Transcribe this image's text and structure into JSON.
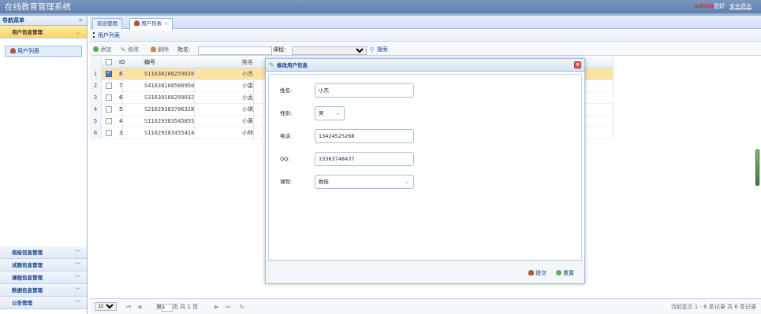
{
  "app": {
    "title": "在线教育管理系统"
  },
  "user": {
    "name": "admin",
    "greeting": "您好",
    "logout": "安全退出"
  },
  "sidebar": {
    "title": "导航菜单",
    "collapse": "«",
    "active_section": "用户信息管理",
    "active_items": [
      "用户列表"
    ],
    "sections": [
      "班级信息管理",
      "试题信息管理",
      "课程信息管理",
      "数据信息管理",
      "公告管理"
    ]
  },
  "tabs": [
    {
      "label": "欢迎使用"
    },
    {
      "label": "用户列表",
      "close": "×"
    }
  ],
  "breadcrumb": "用户列表",
  "toolbar": {
    "add": "添加",
    "edit": "修改",
    "delete": "删除",
    "name_label": "姓名:",
    "course_label": "课程:",
    "search": "搜索"
  },
  "grid": {
    "headers": {
      "id": "ID",
      "no": "编号",
      "name": "姓名"
    },
    "rows": [
      {
        "rn": "1",
        "id": "8",
        "no": "S11638200259020",
        "name": "小杰",
        "checked": true
      },
      {
        "rn": "2",
        "id": "7",
        "no": "S41638168580950",
        "name": "小雷",
        "checked": false
      },
      {
        "rn": "3",
        "id": "6",
        "no": "S31638168299032",
        "name": "小孟",
        "checked": false
      },
      {
        "rn": "4",
        "id": "5",
        "no": "S21629383706318",
        "name": "小琪",
        "checked": false
      },
      {
        "rn": "5",
        "id": "4",
        "no": "S11629383545855",
        "name": "小黄",
        "checked": false
      },
      {
        "rn": "6",
        "id": "3",
        "no": "S11629383455414",
        "name": "小林",
        "checked": false
      }
    ]
  },
  "pager": {
    "page_size": "10",
    "page_label": "第",
    "page_value": "1",
    "page_of": "页 共 1 页",
    "summary": "当前显示 1 - 6 条记录 共 6 条记录"
  },
  "dialog": {
    "title": "修改用户信息",
    "fields": {
      "name": {
        "label": "姓名:",
        "value": "小杰"
      },
      "gender": {
        "label": "性别:",
        "value": "男"
      },
      "phone": {
        "label": "电话:",
        "value": "13424525268"
      },
      "qq": {
        "label": "QQ:",
        "value": "13363748437"
      },
      "course": {
        "label": "课程:",
        "value": "数技"
      }
    },
    "submit": "提交",
    "reset": "重置"
  },
  "colors": {
    "header": "#6a88b6",
    "selected_row": "#fbe3a3",
    "accent": "#99bbe8"
  }
}
